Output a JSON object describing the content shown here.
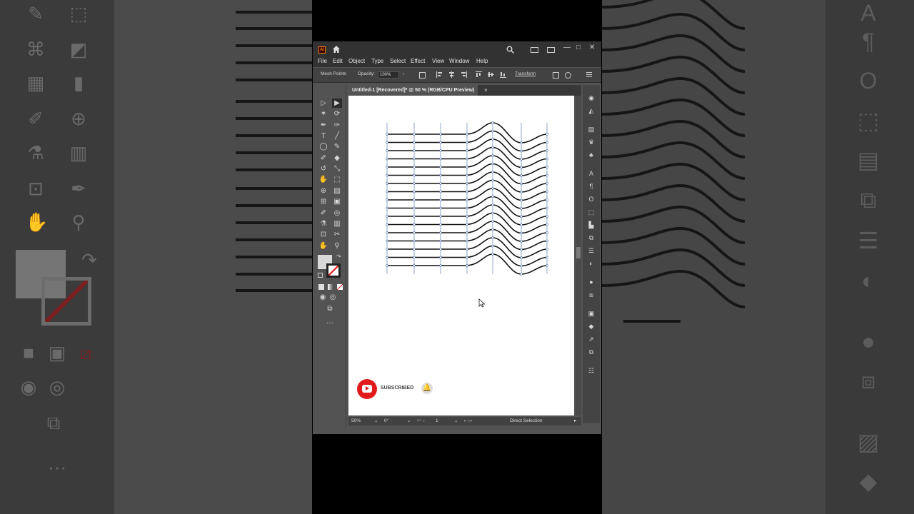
{
  "app": {
    "logo_text": "Ai",
    "menu": [
      "File",
      "Edit",
      "Object",
      "Type",
      "Select",
      "Effect",
      "View",
      "Window",
      "Help"
    ],
    "window_controls": [
      "—",
      "□",
      "✕"
    ]
  },
  "control_bar": {
    "selection_label": "Mesh Points",
    "opacity_label": "Opacity:",
    "opacity_value": "100%",
    "transform_label": "Transform"
  },
  "document": {
    "tab_title": "Untitled-1 [Recovered]* @ 50 % (RGB/CPU Preview)",
    "tab_close": "×"
  },
  "overlay": {
    "subscribed_text": "SUBSCRIBED"
  },
  "status_bar": {
    "zoom": "50%",
    "rotation": "0°",
    "artboard": "1",
    "current_tool": "Direct Selection"
  },
  "colors": {
    "accent": "#ff7c00",
    "youtube_red": "#e11b1b",
    "canvas": "#ffffff",
    "anchor_blue": "#4a6fa5"
  },
  "icons": {
    "home": "home-icon",
    "search": "search-icon",
    "selection_tool": "arrow-icon",
    "direct_selection": "direct-selection-icon",
    "bell": "bell-icon"
  }
}
